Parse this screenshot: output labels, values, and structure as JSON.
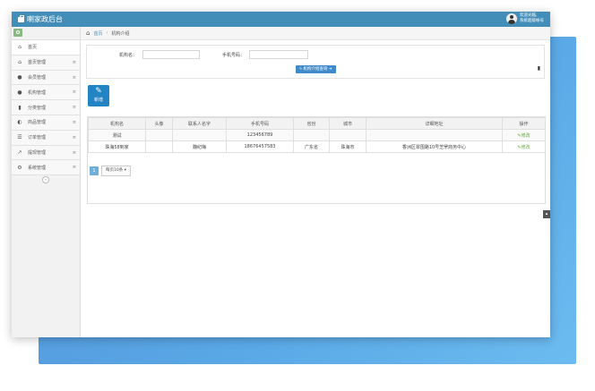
{
  "header": {
    "title": "喇家政后台",
    "user_greeting": "欢迎光临,",
    "user_name": "系统超级帐号"
  },
  "sidebar": {
    "items": [
      {
        "icon": "home-icon",
        "glyph": "⌂",
        "label": "首页",
        "arrow": ""
      },
      {
        "icon": "home-manage-icon",
        "glyph": "⌂",
        "label": "首页管理",
        "arrow": "≡"
      },
      {
        "icon": "member-icon",
        "glyph": "●",
        "label": "会员管理",
        "arrow": "≡"
      },
      {
        "icon": "agency-icon",
        "glyph": "●",
        "label": "机构管理",
        "arrow": "≡"
      },
      {
        "icon": "bookmark-icon",
        "glyph": "▮",
        "label": "分类管理",
        "arrow": "≡"
      },
      {
        "icon": "product-icon",
        "glyph": "◐",
        "label": "商品管理",
        "arrow": "≡"
      },
      {
        "icon": "order-icon",
        "glyph": "☰",
        "label": "订单管理",
        "arrow": "≡"
      },
      {
        "icon": "withdraw-icon",
        "glyph": "↗",
        "label": "提现管理",
        "arrow": "≡"
      },
      {
        "icon": "system-icon",
        "glyph": "⚙",
        "label": "系统管理",
        "arrow": "≡"
      }
    ]
  },
  "breadcrumb": {
    "home": "首页",
    "current": "机构介绍"
  },
  "search": {
    "label_name": "机构名：",
    "label_phone": "手机号码：",
    "name_value": "",
    "phone_value": "",
    "button": "机构介绍查询 ➔"
  },
  "add_button": "新增",
  "table": {
    "headers": [
      "机构名",
      "头像",
      "联系人名字",
      "手机号码",
      "省份",
      "城市",
      "详细地址",
      "操作"
    ],
    "rows": [
      {
        "name": "测试",
        "avatar": "",
        "contact": "",
        "phone": "123456789",
        "province": "",
        "city": "",
        "address": "",
        "op": "✎修改"
      },
      {
        "name": "珠海58到家",
        "avatar": "",
        "contact": "魏纪梅",
        "phone": "18676457583",
        "province": "广东省",
        "city": "珠海市",
        "address": "香洲区翠围路10号芝罘商务中心",
        "op": "✎修改"
      }
    ]
  },
  "pager": {
    "page": "1",
    "per_page": "每页10条"
  },
  "colors": {
    "topbar": "#438eb9",
    "accent": "#2283c5",
    "edit": "#69aa46"
  }
}
